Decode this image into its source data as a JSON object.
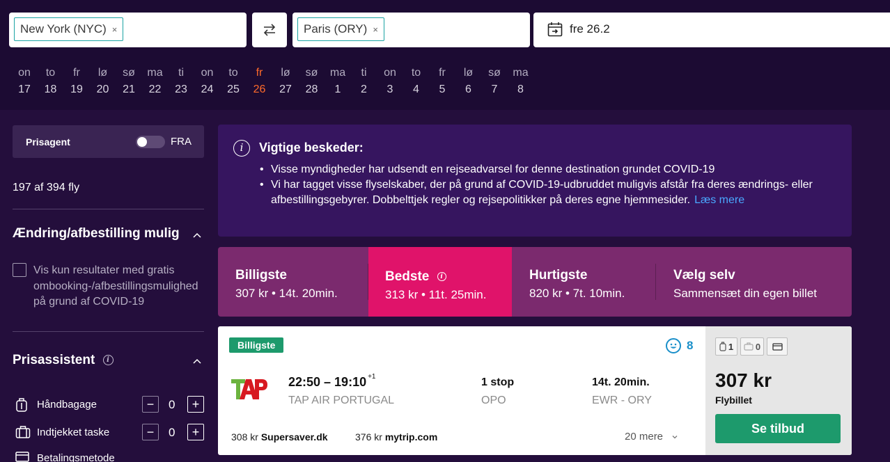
{
  "search": {
    "origin": "New York (NYC)",
    "destination": "Paris (ORY)",
    "remove_glyph": "×",
    "date": "fre 26.2"
  },
  "days": [
    {
      "name": "on",
      "num": "17"
    },
    {
      "name": "to",
      "num": "18"
    },
    {
      "name": "fr",
      "num": "19"
    },
    {
      "name": "lø",
      "num": "20"
    },
    {
      "name": "sø",
      "num": "21"
    },
    {
      "name": "ma",
      "num": "22"
    },
    {
      "name": "ti",
      "num": "23"
    },
    {
      "name": "on",
      "num": "24"
    },
    {
      "name": "to",
      "num": "25"
    },
    {
      "name": "fr",
      "num": "26"
    },
    {
      "name": "lø",
      "num": "27"
    },
    {
      "name": "sø",
      "num": "28"
    },
    {
      "name": "ma",
      "num": "1"
    },
    {
      "name": "ti",
      "num": "2"
    },
    {
      "name": "on",
      "num": "3"
    },
    {
      "name": "to",
      "num": "4"
    },
    {
      "name": "fr",
      "num": "5"
    },
    {
      "name": "lø",
      "num": "6"
    },
    {
      "name": "sø",
      "num": "7"
    },
    {
      "name": "ma",
      "num": "8"
    }
  ],
  "sidebar": {
    "prisagent_label": "Prisagent",
    "prisagent_state": "FRA",
    "count": "197 af 394 fly",
    "change_title": "Ændring/afbestilling mulig",
    "change_checkbox_lines": [
      "Vis kun resultater med gratis",
      "ombooking-/afbestillingsmulighed",
      "på grund af COVID-19"
    ],
    "assistant_title": "Prisassistent",
    "hand_bag_label": "Håndbagage",
    "hand_bag_value": "0",
    "checked_bag_label": "Indtjekket taske",
    "checked_bag_value": "0",
    "payment_label": "Betalingsmetode",
    "minus": "−",
    "plus": "+"
  },
  "messages": {
    "title": "Vigtige beskeder:",
    "item1": "Visse myndigheder har udsendt en rejseadvarsel for denne destination grundet COVID-19",
    "item2": "Vi har tagget visse flyselskaber, der på grund af COVID-19-udbruddet muligvis afstår fra deres ændrings- eller afbestillingsgebyrer. Dobbelttjek regler og rejsepolitikker på deres egne hjemmesider.",
    "link": "Læs mere"
  },
  "tabs": [
    {
      "title": "Billigste",
      "sub": "307 kr • 14t. 20min."
    },
    {
      "title": "Bedste",
      "sub": "313 kr • 11t. 25min."
    },
    {
      "title": "Hurtigste",
      "sub": "820 kr • 7t. 10min."
    },
    {
      "title": "Vælg selv",
      "sub": "Sammensæt din egen billet"
    }
  ],
  "result": {
    "badge": "Billigste",
    "score": "8",
    "times": "22:50 – 19:10",
    "day_offset": "+1",
    "airline": "TAP AIR PORTUGAL",
    "stops": "1 stop",
    "via": "OPO",
    "duration": "14t. 20min.",
    "route": "EWR - ORY",
    "provider1_price": "308 kr",
    "provider1_name": "Supersaver.dk",
    "provider2_price": "376 kr",
    "provider2_name": "mytrip.com",
    "more": "20 mere",
    "carryon_count": "1",
    "checked_count": "0",
    "price": "307 kr",
    "price_label": "Flybillet",
    "cta": "Se tilbud"
  },
  "colors": {
    "background": "#1c0b33",
    "accent_orange": "#ff6a2a",
    "active_tab": "#e0136a",
    "tabs_bg": "#7b2a6e",
    "cta_green": "#1d9a6c"
  }
}
